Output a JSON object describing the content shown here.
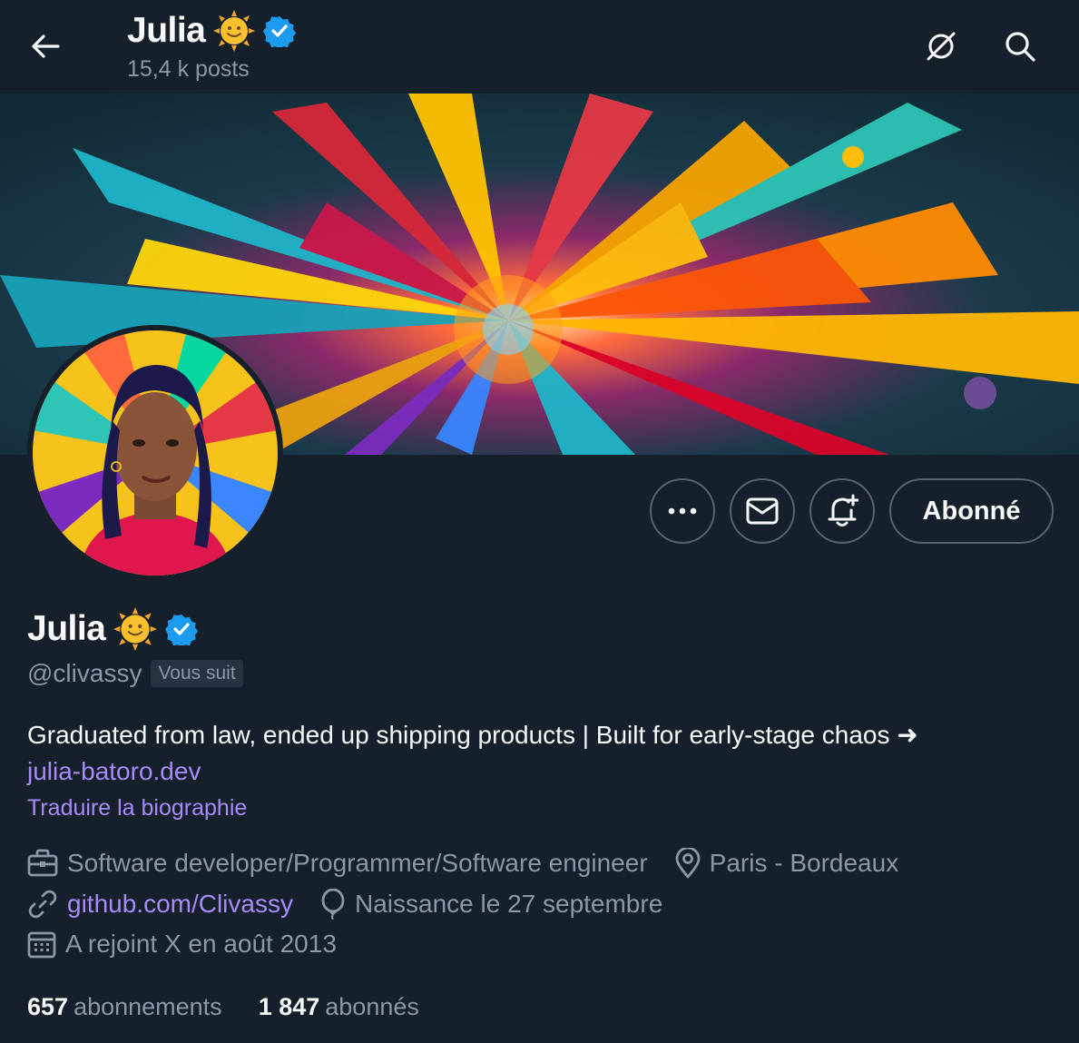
{
  "header": {
    "title": "Julia",
    "post_count": "15,4 k posts"
  },
  "profile": {
    "name": "Julia",
    "handle": "@clivassy",
    "follows_you_badge": "Vous suit",
    "bio_text": "Graduated from law, ended up shipping products | Built for early-stage chaos ➜",
    "bio_link": "julia-batoro.dev",
    "translate_bio": "Traduire la biographie",
    "profession": "Software developer/Programmer/Software engineer",
    "location": "Paris - Bordeaux",
    "website": "github.com/Clivassy",
    "birthday": "Naissance le 27 septembre",
    "joined": "A rejoint X en août 2013"
  },
  "actions": {
    "follow_state_label": "Abonné"
  },
  "stats": {
    "following_count": "657",
    "following_label": "abonnements",
    "followers_count": "1 847",
    "followers_label": "abonnés"
  },
  "colors": {
    "background": "#15202b",
    "verified_badge": "#1d9bf0",
    "link": "#a78bfa",
    "secondary_text": "#8b98a5"
  },
  "icons": [
    "back-arrow-icon",
    "sun-emoji-icon",
    "verified-badge-icon",
    "grok-icon",
    "search-icon",
    "more-icon",
    "message-icon",
    "notification-bell-icon",
    "briefcase-icon",
    "location-pin-icon",
    "link-icon",
    "birthday-balloon-icon",
    "calendar-icon"
  ]
}
